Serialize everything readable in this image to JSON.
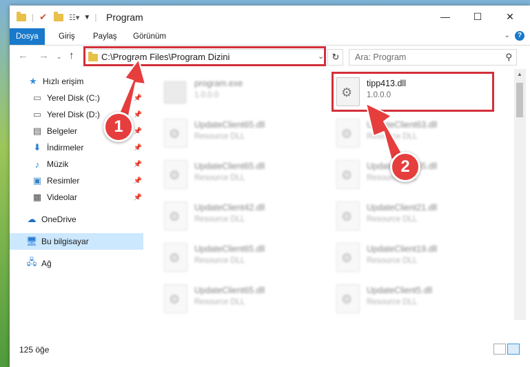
{
  "window": {
    "title": "Program"
  },
  "ribbon": {
    "tabs": [
      {
        "label": "Dosya",
        "active": true
      },
      {
        "label": "Giriş"
      },
      {
        "label": "Paylaş"
      },
      {
        "label": "Görünüm"
      }
    ]
  },
  "address": {
    "path": "C:\\Program Files\\Program Dizini"
  },
  "search": {
    "placeholder": "Ara: Program"
  },
  "sidebar": {
    "items": [
      {
        "label": "Hızlı erişim",
        "icon": "star-icon"
      },
      {
        "label": "Yerel Disk (C:)",
        "icon": "drive-icon",
        "pinned": true
      },
      {
        "label": "Yerel Disk (D:)",
        "icon": "drive-icon",
        "pinned": true
      },
      {
        "label": "Belgeler",
        "icon": "document-icon",
        "pinned": true
      },
      {
        "label": "İndirmeler",
        "icon": "download-icon",
        "pinned": true
      },
      {
        "label": "Müzik",
        "icon": "music-icon",
        "pinned": true
      },
      {
        "label": "Resimler",
        "icon": "pictures-icon",
        "pinned": true
      },
      {
        "label": "Videolar",
        "icon": "video-icon",
        "pinned": true
      },
      {
        "label": "OneDrive",
        "icon": "cloud-icon"
      },
      {
        "label": "Bu bilgisayar",
        "icon": "computer-icon",
        "selected": true
      },
      {
        "label": "Ağ",
        "icon": "network-icon"
      }
    ]
  },
  "files": {
    "highlighted": {
      "name": "tipp413.dll",
      "version": "1.0.0.0"
    },
    "blurred": [
      {
        "name": "program.exe",
        "sub": "1.0.0.0"
      },
      {
        "name": "UpdateClient65.dll",
        "sub": "Resource DLL"
      },
      {
        "name": "UpdateClient63.dll",
        "sub": "Resource DLL"
      },
      {
        "name": "UpdateClient65.dll",
        "sub": "Resource DLL"
      },
      {
        "name": "UpdateClient65.dll",
        "sub": "Resource DLL"
      },
      {
        "name": "UpdateClient42.dll",
        "sub": "Resource DLL"
      },
      {
        "name": "UpdateClient21.dll",
        "sub": "Resource DLL"
      },
      {
        "name": "UpdateClient65.dll",
        "sub": "Resource DLL"
      },
      {
        "name": "UpdateClient19.dll",
        "sub": "Resource DLL"
      },
      {
        "name": "UpdateClient65.dll",
        "sub": "Resource DLL"
      },
      {
        "name": "UpdateClient5.dll",
        "sub": "Resource DLL"
      }
    ]
  },
  "status": {
    "item_count": "125 öğe"
  },
  "callouts": {
    "first": "1",
    "second": "2"
  },
  "colors": {
    "accent": "#1979ca",
    "highlight": "#d32f3a",
    "badge": "#e63d3d"
  }
}
